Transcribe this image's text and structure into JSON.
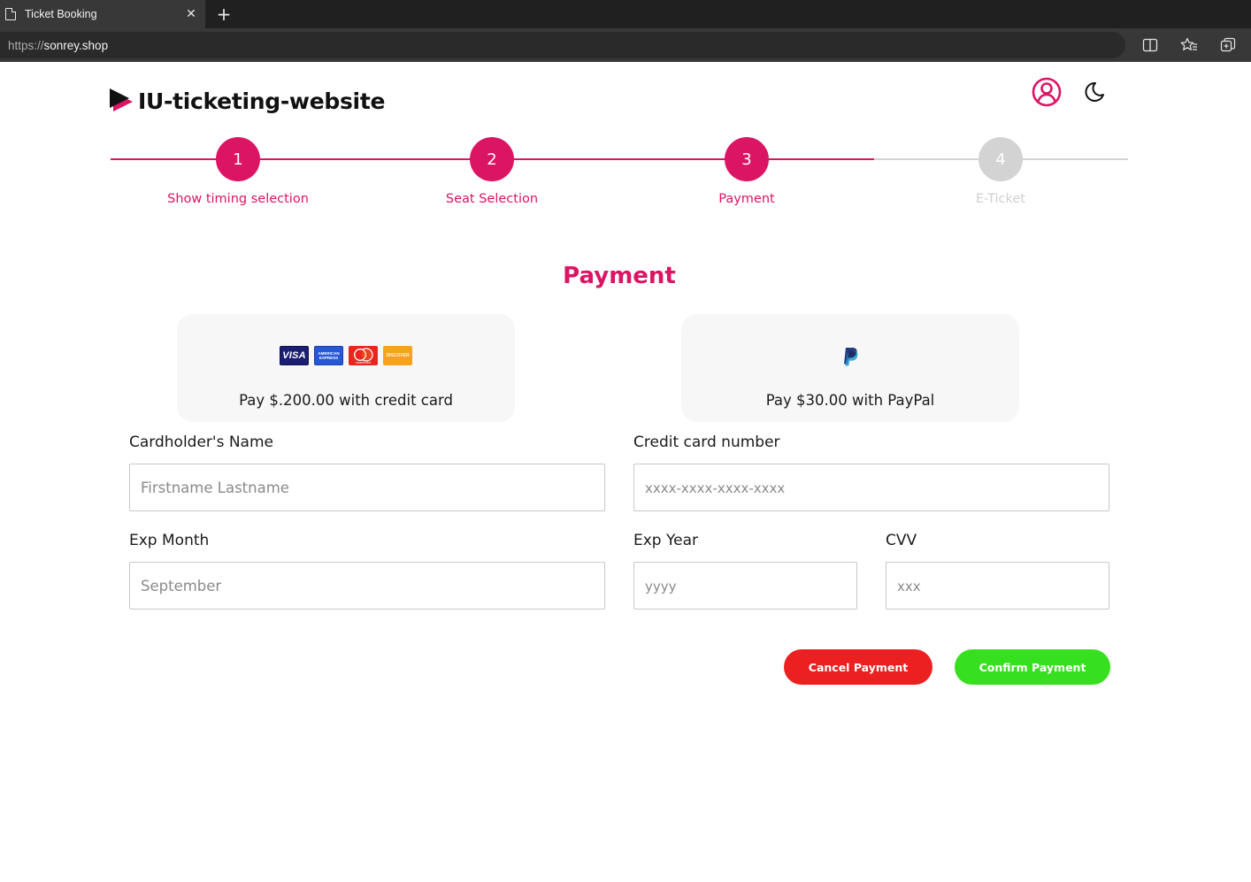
{
  "browser": {
    "tab_title": "Ticket Booking",
    "tab_close": "✕",
    "new_tab": "+",
    "url_protocol": "https://",
    "url_host": "sonrey.shop"
  },
  "header": {
    "brand_title": "IU-ticketing-website",
    "user_icon": "user-circle-icon",
    "theme_icon": "moon-icon"
  },
  "stepper": {
    "steps": [
      {
        "number": "1",
        "label": "Show timing selection",
        "state": "complete"
      },
      {
        "number": "2",
        "label": "Seat Selection",
        "state": "complete"
      },
      {
        "number": "3",
        "label": "Payment",
        "state": "active"
      },
      {
        "number": "4",
        "label": "E-Ticket",
        "state": "inactive"
      }
    ]
  },
  "payment": {
    "title": "Payment",
    "credit_card_option": {
      "text": "Pay $.200.00 with credit card",
      "logos": [
        "VISA",
        "AMERICAN EXPRESS",
        "mastercard",
        "DISCOVER"
      ]
    },
    "paypal_option": {
      "text": "Pay $30.00 with PayPal",
      "logo": "paypal-icon"
    },
    "fields": {
      "cardholder_label": "Cardholder's Name",
      "cardholder_placeholder": "Firstname Lastname",
      "card_number_label": "Credit card number",
      "card_number_placeholder": "xxxx-xxxx-xxxx-xxxx",
      "exp_month_label": "Exp Month",
      "exp_month_placeholder": "September",
      "exp_year_label": "Exp Year",
      "exp_year_placeholder": "yyyy",
      "cvv_label": "CVV",
      "cvv_placeholder": "xxx"
    },
    "buttons": {
      "cancel": "Cancel Payment",
      "confirm": "Confirm Payment"
    }
  },
  "colors": {
    "accent": "#dc1464",
    "inactive": "#d3d3d3",
    "inactive_text": "#cfcfcf",
    "cancel": "#ec2020",
    "confirm": "#37e01e"
  }
}
